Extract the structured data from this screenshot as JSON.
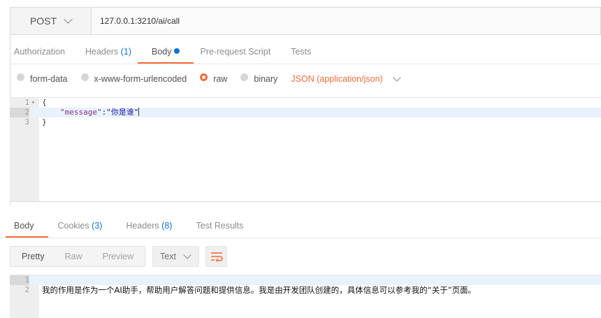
{
  "request": {
    "method": "POST",
    "url": "127.0.0.1:3210/ai/call"
  },
  "request_tabs": [
    {
      "label": "Authorization"
    },
    {
      "label": "Headers",
      "count": "(1)"
    },
    {
      "label": "Body",
      "active": true,
      "has_dot": true
    },
    {
      "label": "Pre-request Script"
    },
    {
      "label": "Tests"
    }
  ],
  "body_types": [
    {
      "label": "form-data",
      "checked": false
    },
    {
      "label": "x-www-form-urlencoded",
      "checked": false
    },
    {
      "label": "raw",
      "checked": true
    },
    {
      "label": "binary",
      "checked": false
    }
  ],
  "content_type": "JSON (application/json)",
  "request_body": {
    "lines": [
      {
        "num": "1",
        "text": "{"
      },
      {
        "num": "2",
        "key": "\"message\"",
        "sep": ":",
        "value": "\"你是谁\""
      },
      {
        "num": "3",
        "text": "}"
      }
    ]
  },
  "response_tabs": [
    {
      "label": "Body",
      "active": true
    },
    {
      "label": "Cookies",
      "count": "(3)"
    },
    {
      "label": "Headers",
      "count": "(8)"
    },
    {
      "label": "Test Results"
    }
  ],
  "response_views": [
    "Pretty",
    "Raw",
    "Preview"
  ],
  "response_format": "Text",
  "response_body": {
    "lines": [
      {
        "num": "1",
        "text": ""
      },
      {
        "num": "2",
        "text": "我的作用是作为一个AI助手，帮助用户解答问题和提供信息。我是由开发团队创建的，具体信息可以参考我的“关于”页面。"
      }
    ]
  },
  "colors": {
    "accent": "#f26b3a",
    "link_blue": "#0f73d6"
  }
}
